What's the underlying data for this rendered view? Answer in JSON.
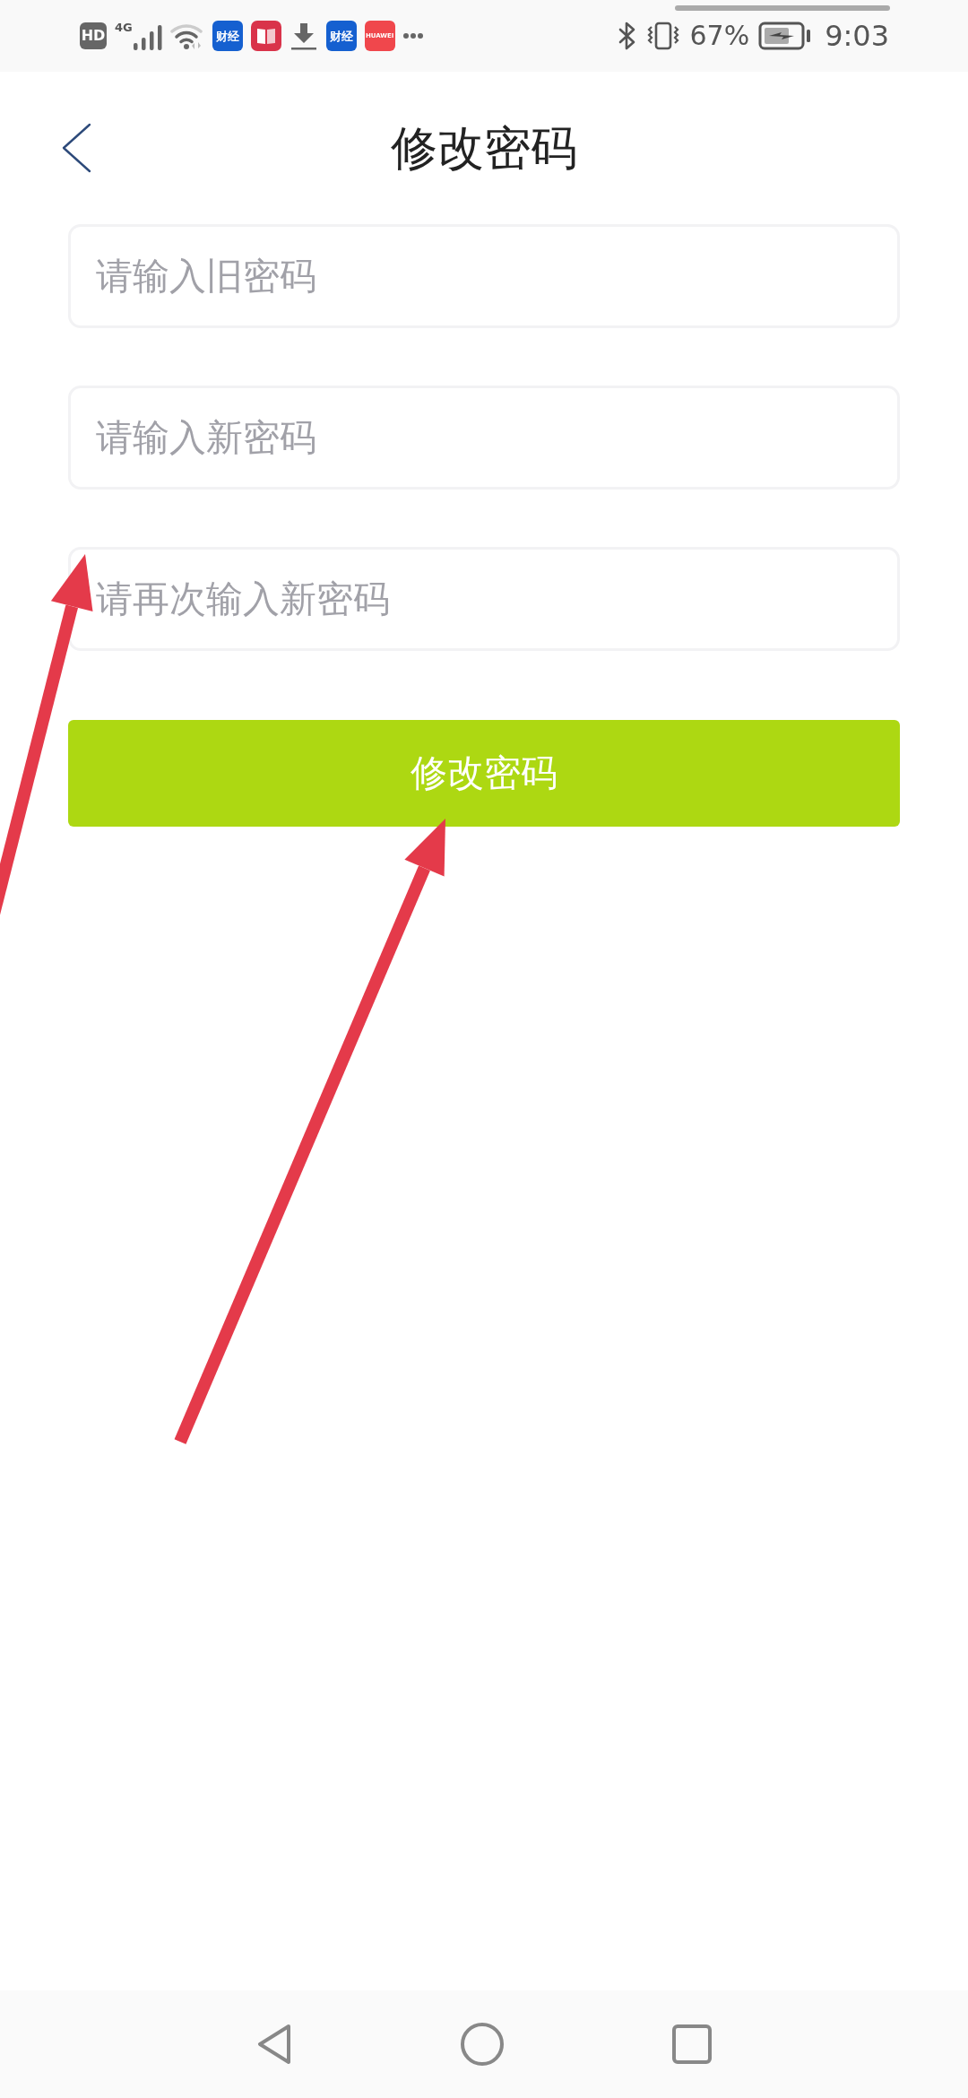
{
  "status_bar": {
    "left_icons": [
      {
        "kind": "hd",
        "text": "HD"
      },
      {
        "kind": "cellular",
        "text": "4G"
      },
      {
        "kind": "wifi"
      },
      {
        "kind": "app",
        "text": "财经",
        "color": "#1560d0"
      },
      {
        "kind": "book"
      },
      {
        "kind": "download"
      },
      {
        "kind": "app",
        "text": "财经",
        "color": "#1560d0"
      },
      {
        "kind": "app",
        "text": "HUAWEI",
        "color": "#f0474c"
      },
      {
        "kind": "more"
      }
    ],
    "battery": "67%",
    "time": "9:03"
  },
  "header": {
    "title": "修改密码"
  },
  "fields": [
    {
      "placeholder": "请输入旧密码"
    },
    {
      "placeholder": "请输入新密码"
    },
    {
      "placeholder": "请再次输入新密码"
    }
  ],
  "submit_button": {
    "label": "修改密码"
  }
}
